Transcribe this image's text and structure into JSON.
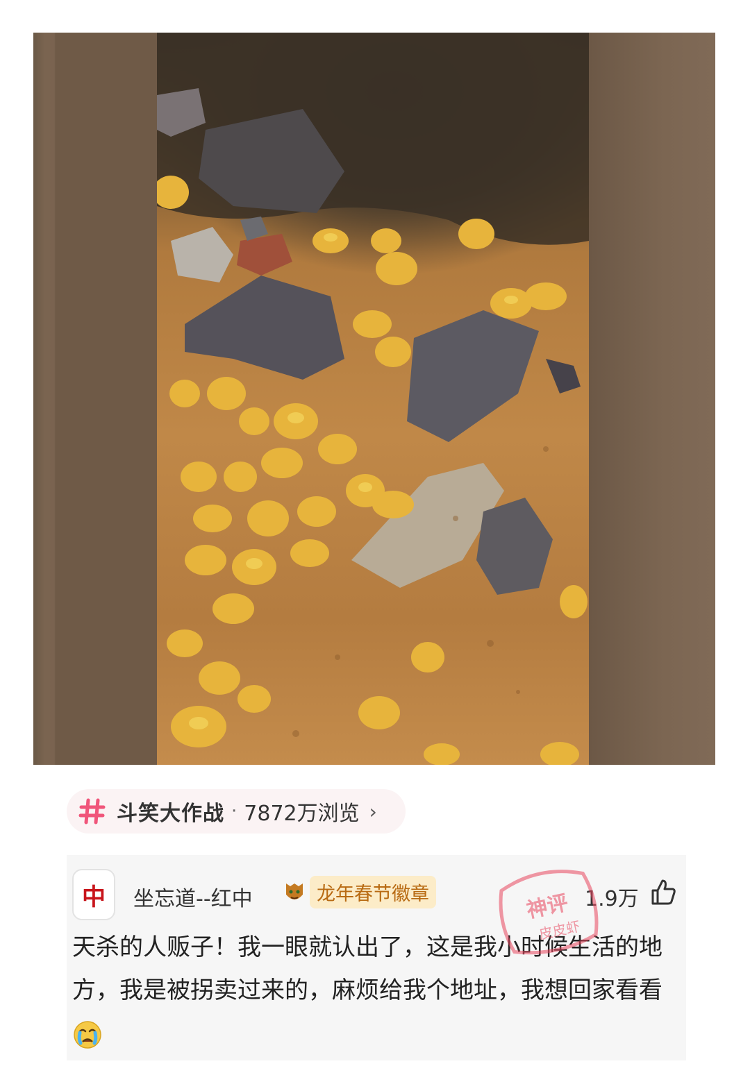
{
  "post": {
    "media": {
      "kind": "video-frame",
      "subject": "yellow-pebbles-and-gray-rocks"
    }
  },
  "topic": {
    "icon": "hashtag-icon",
    "name": "斗笑大作战",
    "separator": "·",
    "views": "7872万浏览",
    "arrow": "›"
  },
  "comment": {
    "avatar_char": "中",
    "username": "坐忘道--红中",
    "badge": {
      "icon": "tiger-badge-icon",
      "label": "龙年春节徽章"
    },
    "likes": "1.9万",
    "like_icon": "thumbs-up-icon",
    "text": "天杀的人贩子！我一眼就认出了，这是我小时候生活的地方，我是被拐卖过来的，麻烦给我个地址，我想回家看看",
    "emoji": "crying-face-icon"
  },
  "watermark": {
    "line1": "神评",
    "line2": "皮皮虾"
  },
  "colors": {
    "topic_bg": "#fbf3f4",
    "hashtag": "#f0557a",
    "badge_bg": "#fcecc8",
    "badge_text": "#b86a12",
    "avatar_char": "#c8141b",
    "comment_bg": "#f6f6f6",
    "watermark": "#e8475f"
  }
}
